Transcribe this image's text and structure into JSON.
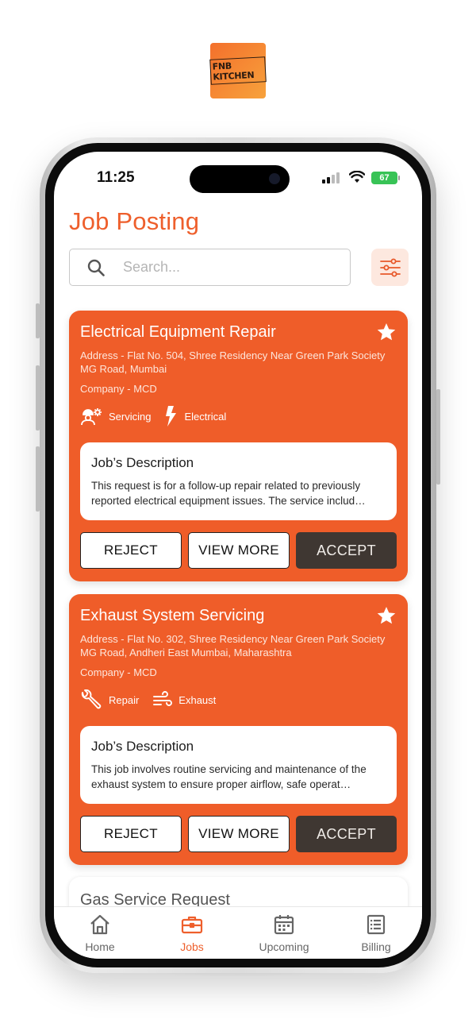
{
  "brand": {
    "logo_text": "FNB KITCHEN"
  },
  "status_bar": {
    "time": "11:25",
    "battery": "67"
  },
  "header": {
    "title": "Job Posting"
  },
  "search": {
    "placeholder": "Search..."
  },
  "colors": {
    "accent": "#ef5d29",
    "accept_button": "#3f3732",
    "filter_bg": "#fde8df"
  },
  "jobs": [
    {
      "title": "Electrical Equipment Repair",
      "address_line1": "Address - Flat No. 504, Shree Residency Near Green Park Society",
      "address_line2": "MG Road, Mumbai",
      "company": "Company - MCD",
      "tags": [
        {
          "label": "Servicing",
          "icon": "technician-gear-icon"
        },
        {
          "label": "Electrical",
          "icon": "lightning-icon"
        }
      ],
      "description_title": "Job’s Description",
      "description": "This request is for a follow-up repair related to previously reported electrical equipment issues. The service includ…",
      "reject_label": "REJECT",
      "view_label": "VIEW MORE",
      "accept_label": "ACCEPT"
    },
    {
      "title": "Exhaust System Servicing",
      "address_line1": "Address - Flat No. 302, Shree Residency Near Green Park Society",
      "address_line2": "MG Road, Andheri East Mumbai, Maharashtra",
      "company": "Company - MCD",
      "tags": [
        {
          "label": "Repair",
          "icon": "wrench-icon"
        },
        {
          "label": "Exhaust",
          "icon": "wind-icon"
        }
      ],
      "description_title": "Job’s Description",
      "description": "This job involves routine servicing and maintenance of the exhaust system to ensure proper airflow, safe operat…",
      "reject_label": "REJECT",
      "view_label": "VIEW MORE",
      "accept_label": "ACCEPT"
    },
    {
      "title": "Gas Service Request"
    }
  ],
  "tabbar": {
    "items": [
      {
        "label": "Home",
        "icon": "home-icon"
      },
      {
        "label": "Jobs",
        "icon": "briefcase-icon",
        "active": true
      },
      {
        "label": "Upcoming",
        "icon": "calendar-icon"
      },
      {
        "label": "Billing",
        "icon": "receipt-list-icon"
      }
    ]
  }
}
